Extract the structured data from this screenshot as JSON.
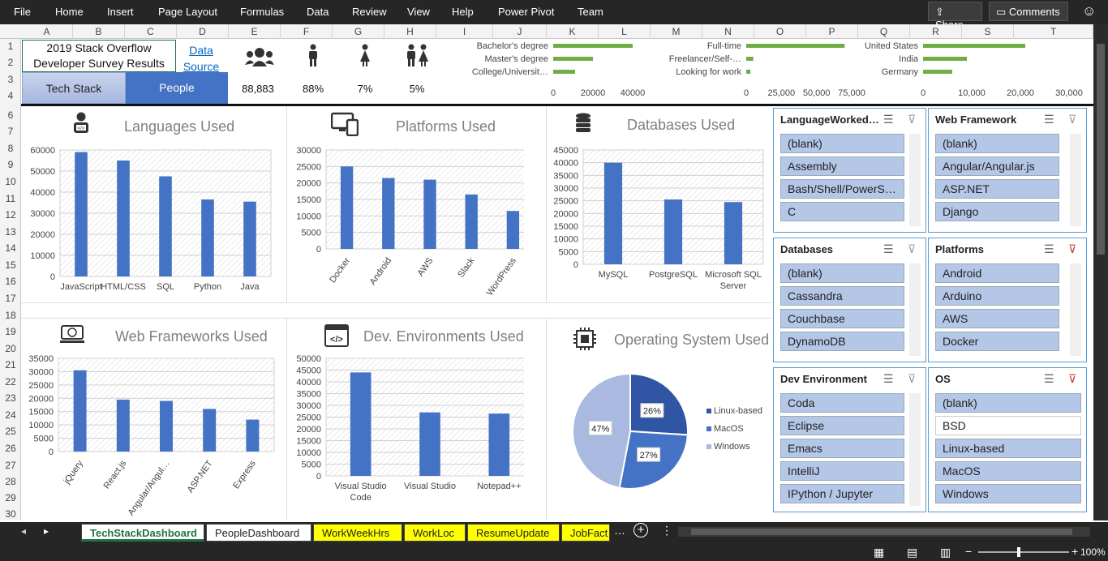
{
  "menu": [
    "File",
    "Home",
    "Insert",
    "Page Layout",
    "Formulas",
    "Data",
    "Review",
    "View",
    "Help",
    "Power Pivot",
    "Team"
  ],
  "share_label": "Share",
  "comments_label": "Comments",
  "columns": [
    "A",
    "B",
    "C",
    "D",
    "E",
    "F",
    "G",
    "H",
    "I",
    "J",
    "K",
    "L",
    "M",
    "N",
    "O",
    "P",
    "Q",
    "R",
    "S",
    "T"
  ],
  "rows": [
    "1",
    "2",
    "3",
    "4",
    "6",
    "7",
    "8",
    "9",
    "10",
    "11",
    "12",
    "13",
    "14",
    "15",
    "16",
    "17",
    "18",
    "19",
    "20",
    "21",
    "22",
    "23",
    "24",
    "25",
    "26",
    "27",
    "28",
    "29",
    "30"
  ],
  "header": {
    "title_line1": "2019 Stack Overflow",
    "title_line2": "Developer Survey Results",
    "data_link1": "Data",
    "data_link2": "Source",
    "tab_techstack": "Tech Stack",
    "tab_people": "People",
    "respondents": "88,883",
    "male_pct": "88%",
    "female_pct": "7%",
    "other_pct": "5%"
  },
  "mini_edu": {
    "labels": [
      "Bachelor's degree",
      "Master's degree",
      "College/Universit…"
    ],
    "values": [
      40000,
      20000,
      11000
    ],
    "ticks": [
      "0",
      "20000",
      "40000"
    ]
  },
  "mini_emp": {
    "labels": [
      "Full-time",
      "Freelancer/Self-…",
      "Looking for work"
    ],
    "values": [
      70000,
      5000,
      3000
    ],
    "ticks": [
      "0",
      "25,000",
      "50,000",
      "75,000"
    ]
  },
  "mini_country": {
    "labels": [
      "United States",
      "India",
      "Germany"
    ],
    "values": [
      21000,
      9000,
      6000
    ],
    "ticks": [
      "0",
      "10,000",
      "20,000",
      "30,000"
    ]
  },
  "chart_data": [
    {
      "type": "bar",
      "title": "Languages Used",
      "categories": [
        "JavaScript",
        "HTML/CSS",
        "SQL",
        "Python",
        "Java"
      ],
      "values": [
        59000,
        55000,
        47500,
        36500,
        35500
      ],
      "ylim": [
        0,
        60000
      ],
      "yticks": [
        "60000",
        "50000",
        "40000",
        "30000",
        "20000",
        "10000",
        "0"
      ]
    },
    {
      "type": "bar",
      "title": "Platforms Used",
      "categories": [
        "Docker",
        "Android",
        "AWS",
        "Slack",
        "WordPress"
      ],
      "values": [
        25000,
        21500,
        21000,
        16500,
        11500
      ],
      "ylim": [
        0,
        30000
      ],
      "yticks": [
        "30000",
        "25000",
        "20000",
        "15000",
        "10000",
        "5000",
        "0"
      ]
    },
    {
      "type": "bar",
      "title": "Databases Used",
      "categories": [
        "MySQL",
        "PostgreSQL",
        "Microsoft SQL Server"
      ],
      "values": [
        40000,
        25500,
        24500
      ],
      "ylim": [
        0,
        45000
      ],
      "yticks": [
        "45000",
        "40000",
        "35000",
        "30000",
        "25000",
        "20000",
        "15000",
        "10000",
        "5000",
        "0"
      ]
    },
    {
      "type": "bar",
      "title": "Web Frameworks Used",
      "categories": [
        "jQuery",
        "React.js",
        "Angular/Angul…",
        "ASP.NET",
        "Express"
      ],
      "values": [
        30500,
        19500,
        19000,
        16000,
        12000
      ],
      "ylim": [
        0,
        35000
      ],
      "yticks": [
        "35000",
        "30000",
        "25000",
        "20000",
        "15000",
        "10000",
        "5000",
        "0"
      ]
    },
    {
      "type": "bar",
      "title": "Dev. Environments Used",
      "categories": [
        "Visual Studio Code",
        "Visual Studio",
        "Notepad++"
      ],
      "values": [
        44000,
        27000,
        26500
      ],
      "ylim": [
        0,
        50000
      ],
      "yticks": [
        "50000",
        "45000",
        "40000",
        "35000",
        "30000",
        "25000",
        "20000",
        "15000",
        "10000",
        "5000",
        "0"
      ]
    },
    {
      "type": "pie",
      "title": "Operating System Used",
      "series": [
        {
          "name": "Linux-based",
          "value": 26,
          "label": "26%"
        },
        {
          "name": "MacOS",
          "value": 27,
          "label": "27%"
        },
        {
          "name": "Windows",
          "value": 47,
          "label": "47%"
        }
      ]
    }
  ],
  "colors": {
    "bar": "#4472c4",
    "linux": "#2f55a4",
    "mac": "#4472c4",
    "windows": "#a9b9e0",
    "slicer_item": "#b4c7e7",
    "green": "#70ad47"
  },
  "slicers": [
    {
      "title": "LanguageWorked…",
      "items": [
        "(blank)",
        "Assembly",
        "Bash/Shell/PowerS…",
        "C"
      ]
    },
    {
      "title": "Web Framework",
      "items": [
        "(blank)",
        "Angular/Angular.js",
        "ASP.NET",
        "Django"
      ]
    },
    {
      "title": "Databases",
      "items": [
        "(blank)",
        "Cassandra",
        "Couchbase",
        "DynamoDB"
      ]
    },
    {
      "title": "Platforms",
      "items": [
        "Android",
        "Arduino",
        "AWS",
        "Docker"
      ]
    },
    {
      "title": "Dev Environment",
      "items": [
        "Coda",
        "Eclipse",
        "Emacs",
        "IntelliJ",
        "IPython / Jupyter"
      ]
    },
    {
      "title": "OS",
      "items": [
        "(blank)",
        "BSD",
        "Linux-based",
        "MacOS",
        "Windows"
      ]
    }
  ],
  "sheet_tabs": [
    "TechStackDashboard",
    "PeopleDashboard",
    "WorkWeekHrs",
    "WorkLoc",
    "ResumeUpdate",
    "JobFact"
  ],
  "zoom": "100%"
}
